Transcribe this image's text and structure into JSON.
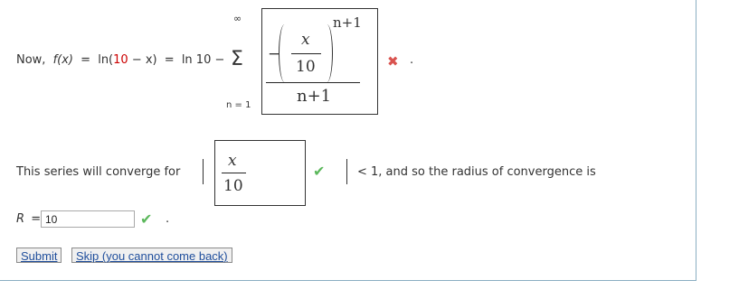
{
  "question": {
    "prefix": "Now,",
    "f_of_x": "f(x)",
    "eq1": "=",
    "ln": "ln(",
    "ten1": "10",
    "minus_x": "− x)",
    "eq2": "=",
    "ln10": "ln 10 −",
    "sigma": "Σ",
    "upper_limit": "∞",
    "lower_limit": "n = 1",
    "neg": "−",
    "x": "x",
    "ten2": "10",
    "exponent": "n+1",
    "denominator": "n+1",
    "mark": "✖",
    "period": "."
  },
  "convergence": {
    "label": "This series will converge for",
    "x": "x",
    "ten": "10",
    "tail": "< 1, and so the radius of convergence is",
    "mark": "✔"
  },
  "radius": {
    "label": "R",
    "eq": "=",
    "value": "10",
    "mark": "✔",
    "period": "."
  },
  "buttons": {
    "submit": "Submit",
    "skip": "Skip (you cannot come back)"
  },
  "colors": {
    "incorrect": "#d9534f",
    "correct": "#5cb85c",
    "number_red": "#cc0000"
  }
}
